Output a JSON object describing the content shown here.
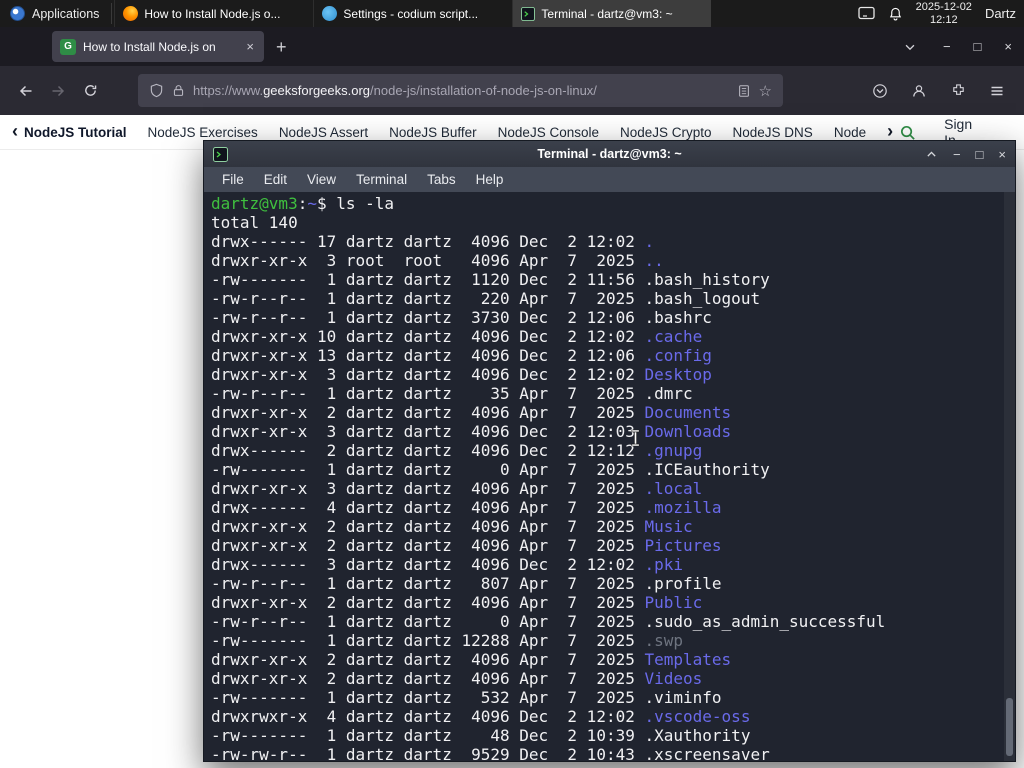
{
  "colors": {
    "prompt_green": "#3fbf3f",
    "dir_blue": "#6a6aea",
    "gfg_green": "#2f8d46",
    "terminal_bg": "#20242f"
  },
  "panel": {
    "applications": "Applications",
    "taskbar": [
      {
        "title": "How to Install Node.js o...",
        "icon": "firefox-icon",
        "active": false
      },
      {
        "title": "Settings - codium script...",
        "icon": "codium-icon",
        "active": false
      },
      {
        "title": "Terminal - dartz@vm3: ~",
        "icon": "terminal-icon",
        "active": true
      }
    ],
    "clock": {
      "date": "2025-12-02",
      "time": "12:12"
    },
    "user": "Dartz"
  },
  "browser": {
    "tab": {
      "title": "How to Install Node.js on"
    },
    "toolbar": {
      "url_scheme": "https://www.",
      "url_domain": "geeksforgeeks.org",
      "url_path": "/node-js/installation-of-node-js-on-linux/"
    },
    "site_nav": {
      "links": [
        "NodeJS Tutorial",
        "NodeJS Exercises",
        "NodeJS Assert",
        "NodeJS Buffer",
        "NodeJS Console",
        "NodeJS Crypto",
        "NodeJS DNS",
        "Node"
      ],
      "back_chevron": "‹",
      "forward_chevron": "›",
      "sign_in": "Sign In"
    },
    "window_controls": {
      "minimize": "−",
      "maximize": "□",
      "close": "×"
    },
    "tab_close": "×",
    "new_tab": "+",
    "star": "☆"
  },
  "terminal": {
    "title": "Terminal - dartz@vm3: ~",
    "menu": [
      "File",
      "Edit",
      "View",
      "Terminal",
      "Tabs",
      "Help"
    ],
    "prompt": {
      "user_host": "dartz@vm3",
      "separator": ":",
      "path": "~",
      "symbol": "$ ",
      "command": "ls -la"
    },
    "total_line": "total 140",
    "controls": {
      "minimize": "−",
      "maximize": "□",
      "close": "×"
    },
    "listing": [
      {
        "meta": "drwx------ 17 dartz dartz  4096 Dec  2 12:02 ",
        "name": ".",
        "kind": "dir"
      },
      {
        "meta": "drwxr-xr-x  3 root  root   4096 Apr  7  2025 ",
        "name": "..",
        "kind": "dir"
      },
      {
        "meta": "-rw-------  1 dartz dartz  1120 Dec  2 11:56 ",
        "name": ".bash_history",
        "kind": "file"
      },
      {
        "meta": "-rw-r--r--  1 dartz dartz   220 Apr  7  2025 ",
        "name": ".bash_logout",
        "kind": "file"
      },
      {
        "meta": "-rw-r--r--  1 dartz dartz  3730 Dec  2 12:06 ",
        "name": ".bashrc",
        "kind": "file"
      },
      {
        "meta": "drwxr-xr-x 10 dartz dartz  4096 Dec  2 12:02 ",
        "name": ".cache",
        "kind": "dir"
      },
      {
        "meta": "drwxr-xr-x 13 dartz dartz  4096 Dec  2 12:06 ",
        "name": ".config",
        "kind": "dir"
      },
      {
        "meta": "drwxr-xr-x  3 dartz dartz  4096 Dec  2 12:02 ",
        "name": "Desktop",
        "kind": "dir"
      },
      {
        "meta": "-rw-r--r--  1 dartz dartz    35 Apr  7  2025 ",
        "name": ".dmrc",
        "kind": "file"
      },
      {
        "meta": "drwxr-xr-x  2 dartz dartz  4096 Apr  7  2025 ",
        "name": "Documents",
        "kind": "dir"
      },
      {
        "meta": "drwxr-xr-x  3 dartz dartz  4096 Dec  2 12:03 ",
        "name": "Downloads",
        "kind": "dir"
      },
      {
        "meta": "drwx------  2 dartz dartz  4096 Dec  2 12:12 ",
        "name": ".gnupg",
        "kind": "dir"
      },
      {
        "meta": "-rw-------  1 dartz dartz     0 Apr  7  2025 ",
        "name": ".ICEauthority",
        "kind": "file"
      },
      {
        "meta": "drwxr-xr-x  3 dartz dartz  4096 Apr  7  2025 ",
        "name": ".local",
        "kind": "dir"
      },
      {
        "meta": "drwx------  4 dartz dartz  4096 Apr  7  2025 ",
        "name": ".mozilla",
        "kind": "dir"
      },
      {
        "meta": "drwxr-xr-x  2 dartz dartz  4096 Apr  7  2025 ",
        "name": "Music",
        "kind": "dir"
      },
      {
        "meta": "drwxr-xr-x  2 dartz dartz  4096 Apr  7  2025 ",
        "name": "Pictures",
        "kind": "dir"
      },
      {
        "meta": "drwx------  3 dartz dartz  4096 Dec  2 12:02 ",
        "name": ".pki",
        "kind": "dir"
      },
      {
        "meta": "-rw-r--r--  1 dartz dartz   807 Apr  7  2025 ",
        "name": ".profile",
        "kind": "file"
      },
      {
        "meta": "drwxr-xr-x  2 dartz dartz  4096 Apr  7  2025 ",
        "name": "Public",
        "kind": "dir"
      },
      {
        "meta": "-rw-r--r--  1 dartz dartz     0 Apr  7  2025 ",
        "name": ".sudo_as_admin_successful",
        "kind": "file"
      },
      {
        "meta": "-rw-------  1 dartz dartz 12288 Apr  7  2025 ",
        "name": ".swp",
        "kind": "dim"
      },
      {
        "meta": "drwxr-xr-x  2 dartz dartz  4096 Apr  7  2025 ",
        "name": "Templates",
        "kind": "dir"
      },
      {
        "meta": "drwxr-xr-x  2 dartz dartz  4096 Apr  7  2025 ",
        "name": "Videos",
        "kind": "dir"
      },
      {
        "meta": "-rw-------  1 dartz dartz   532 Apr  7  2025 ",
        "name": ".viminfo",
        "kind": "file"
      },
      {
        "meta": "drwxrwxr-x  4 dartz dartz  4096 Dec  2 12:02 ",
        "name": ".vscode-oss",
        "kind": "dir"
      },
      {
        "meta": "-rw-------  1 dartz dartz    48 Dec  2 10:39 ",
        "name": ".Xauthority",
        "kind": "file"
      },
      {
        "meta": "-rw-rw-r--  1 dartz dartz  9529 Dec  2 10:43 ",
        "name": ".xscreensaver",
        "kind": "file"
      }
    ]
  }
}
